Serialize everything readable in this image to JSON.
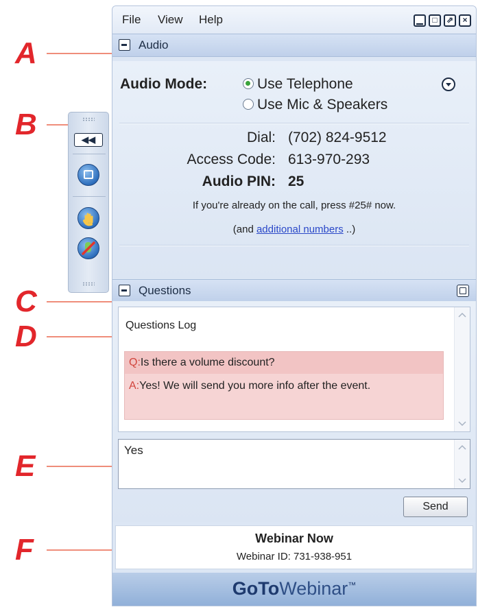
{
  "callouts": [
    "A",
    "B",
    "C",
    "D",
    "E",
    "F"
  ],
  "menu": {
    "file": "File",
    "view": "View",
    "help": "Help"
  },
  "window_controls": {
    "minimize": "▁",
    "maximize": "□",
    "popout": "⇗",
    "close": "×"
  },
  "audio": {
    "title": "Audio",
    "mode_label": "Audio Mode:",
    "options": [
      "Use Telephone",
      "Use Mic & Speakers"
    ],
    "selected_option": "Use Telephone",
    "dial_label": "Dial:",
    "dial_value": "(702) 824-9512",
    "access_label": "Access Code:",
    "access_value": "613-970-293",
    "pin_label": "Audio PIN:",
    "pin_value": "25",
    "already_note": "If you're already on the call, press #25# now.",
    "additional_prefix": "(and ",
    "additional_link": "additional numbers",
    "additional_suffix": " ..)"
  },
  "toolbar": {
    "back_label": "◀◀",
    "icons": [
      "screen-icon",
      "raise-hand-icon",
      "mute-icon"
    ]
  },
  "questions": {
    "title": "Questions",
    "log_title": "Questions Log",
    "q_prefix": "Q:",
    "question": "Is there a volume discount?",
    "a_prefix": "A:",
    "answer": "Yes! We will send you more info after the event.",
    "input_value": "Yes",
    "send_label": "Send"
  },
  "webinar": {
    "title": "Webinar Now",
    "id_text": "Webinar ID: 731-938-951"
  },
  "brand": {
    "strong": "GoTo",
    "light": "Webinar",
    "tm": "™"
  },
  "colors": {
    "callout": "#e2262b",
    "callout_line": "#ef8d7a",
    "link": "#2a48c8",
    "radio_selected": "#39a33b",
    "question_bg": "#f2c4c4"
  }
}
